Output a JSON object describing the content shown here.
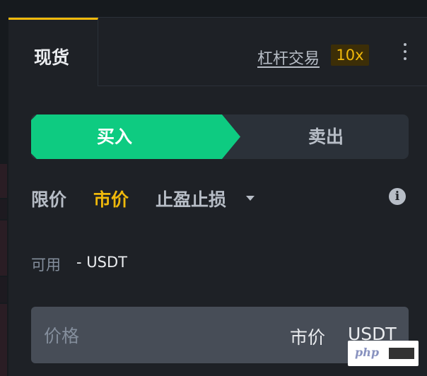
{
  "tabs": {
    "spot_label": "现货",
    "margin_label": "杠杆交易",
    "leverage_badge": "10x",
    "more_icon": "more-vertical-icon"
  },
  "side_toggle": {
    "buy_label": "买入",
    "sell_label": "卖出",
    "buy_color": "#0ecb81",
    "sell_bg": "#2b3139"
  },
  "order_types": {
    "limit": "限价",
    "market": "市价",
    "stop": "止盈止损",
    "active": "市价",
    "active_color": "#f0b90b",
    "info_icon": "info-icon",
    "info_glyph": "i"
  },
  "available": {
    "label": "可用",
    "value": "- USDT"
  },
  "price_field": {
    "placeholder": "价格",
    "mode": "市价",
    "unit": "USDT"
  },
  "watermark": {
    "text": "php"
  },
  "colors": {
    "accent": "#f0b90b",
    "buy": "#0ecb81",
    "panel_bg": "#1e2126",
    "input_bg": "#474d57"
  }
}
